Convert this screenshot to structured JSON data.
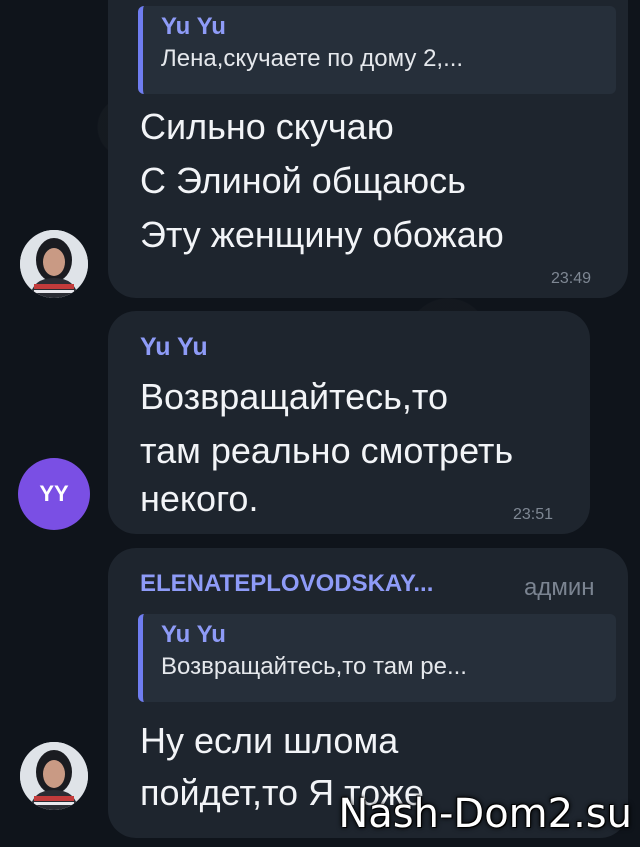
{
  "colors": {
    "background": "#0f141b",
    "bubble": "#1e252e",
    "reply_bar": "#6f7df0",
    "sender_name": "#8e9bf7",
    "avatar_yy": "#7a4fe4"
  },
  "messages": [
    {
      "reply": {
        "name": "Yu Yu",
        "text": "Лена,скучаете по дому 2,..."
      },
      "lines": [
        "Сильно скучаю",
        "С Элиной общаюсь",
        "Эту женщину обожаю"
      ],
      "time": "23:49"
    },
    {
      "sender": "Yu Yu",
      "lines": [
        "Возвращайтесь,то",
        "там реально смотреть",
        "некого."
      ],
      "time": "23:51",
      "avatar_text": "YY"
    },
    {
      "sender": "ELENATEPLOVODSKAY...",
      "role": "админ",
      "reply": {
        "name": "Yu Yu",
        "text": "Возвращайтесь,то там ре..."
      },
      "lines": [
        "Ну если шлома",
        "пойдет,то Я тоже"
      ]
    }
  ],
  "watermark": "Nash-Dom2.su"
}
